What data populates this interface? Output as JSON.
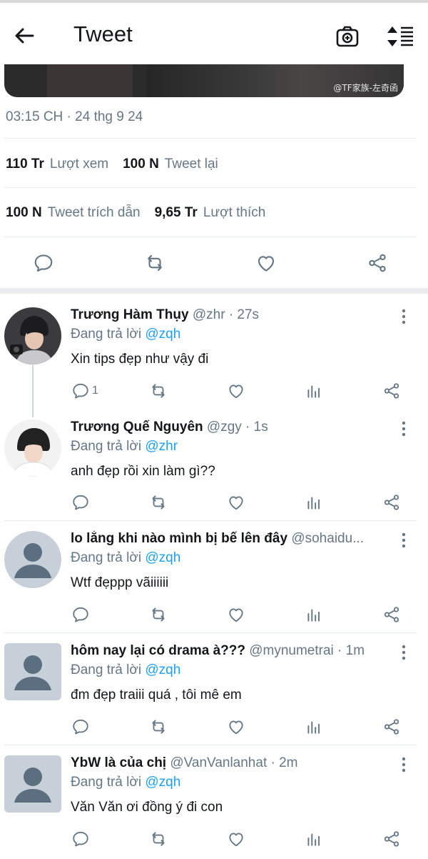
{
  "header": {
    "title": "Tweet",
    "back_icon": "arrow-left-icon",
    "camera_icon": "camera-icon",
    "sort_icon": "sort-icon"
  },
  "media": {
    "watermark": "@TF家族-左奇函"
  },
  "tweet": {
    "timestamp": "03:15 CH · 24 thg 9 24",
    "views_count": "110 Tr",
    "views_label": "Lượt xem",
    "retweets_count": "100 N",
    "retweets_label": "Tweet lại",
    "quotes_count": "100 N",
    "quotes_label": "Tweet trích dẫn",
    "likes_count": "9,65 Tr",
    "likes_label": "Lượt thích"
  },
  "replies": [
    {
      "name": "Trương Hàm Thụy",
      "handle": "@zhr · 27s",
      "replying_prefix": "Đang trả lời",
      "replying_to": "@zqh",
      "text": "Xin tips đẹp như vậy đi",
      "reply_count": "1"
    },
    {
      "name": "Trương Quế Nguyên",
      "handle": "@zgy · 1s",
      "replying_prefix": "Đang trả lời",
      "replying_to": "@zhr",
      "text": "anh đẹp rồi xin làm gì??",
      "reply_count": ""
    },
    {
      "name": "lo lắng khi nào mình bị bế lên đây",
      "handle": "@sohaidu...",
      "replying_prefix": "Đang trả lời",
      "replying_to": "@zqh",
      "text": "Wtf đẹppp vãiiiiii",
      "reply_count": ""
    },
    {
      "name": "hôm nay lại có drama à???",
      "handle": "@mynumetrai · 1m",
      "replying_prefix": "Đang trả lời",
      "replying_to": "@zqh",
      "text": "đm đẹp traiii quá , tôi mê em",
      "reply_count": ""
    },
    {
      "name": "YbW là của chị",
      "handle": "@VanVanlanhat · 2m",
      "replying_prefix": "Đang trả lời",
      "replying_to": "@zqh",
      "text": "Văn Văn ơi đồng ý đi con",
      "reply_count": ""
    }
  ],
  "colors": {
    "accent": "#1da1f2",
    "muted": "#657786",
    "text": "#14171a",
    "divider": "#e6ecf0"
  }
}
